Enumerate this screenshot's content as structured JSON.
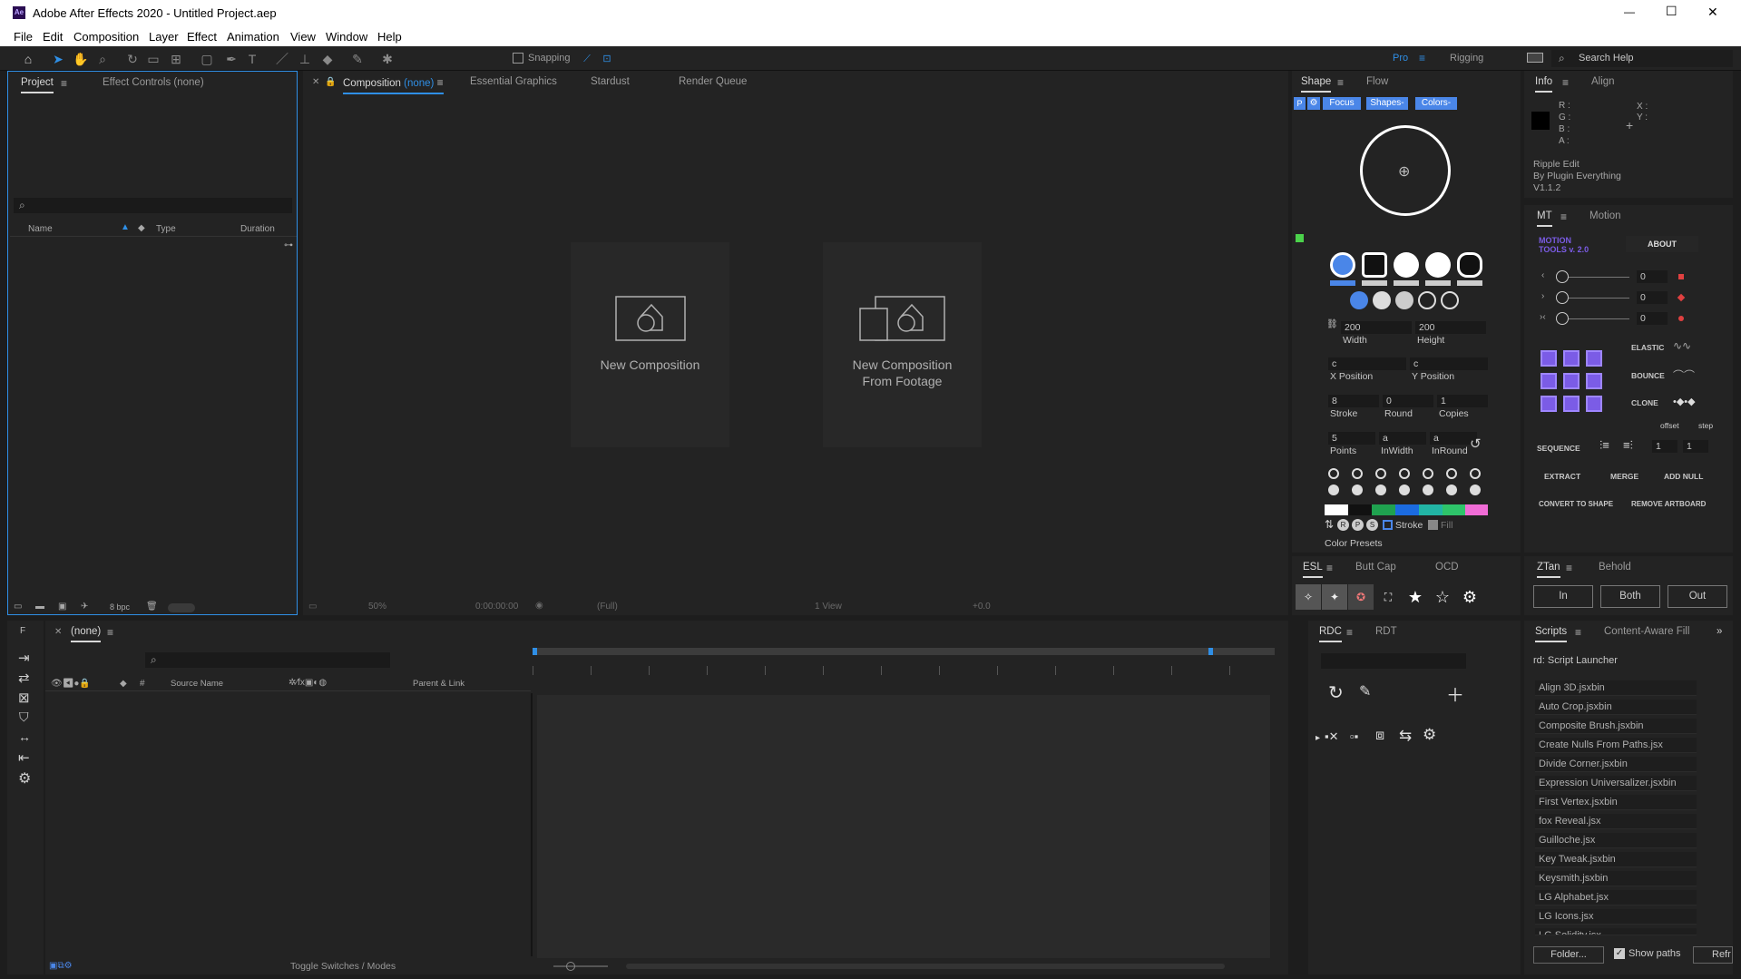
{
  "app": {
    "title": "Adobe After Effects 2020 - Untitled Project.aep",
    "logo": "Ae"
  },
  "window_controls": {
    "minimize": "—",
    "maximize": "☐",
    "close": "✕"
  },
  "menu": [
    "File",
    "Edit",
    "Composition",
    "Layer",
    "Effect",
    "Animation",
    "View",
    "Window",
    "Help"
  ],
  "toolbar": {
    "snapping": "Snapping",
    "workspaces": [
      "Pro",
      "Rigging"
    ],
    "search": "Search Help"
  },
  "project_panel": {
    "tabs": [
      "Project",
      "Effect Controls (none)"
    ],
    "columns": [
      "Name",
      "Type",
      "Duration"
    ],
    "bpc": "8 bpc"
  },
  "comp_panel": {
    "tabs": [
      "Composition",
      "(none)",
      "Essential Graphics",
      "Stardust",
      "Render Queue"
    ],
    "new_comp": "New Composition",
    "new_comp_footage_1": "New Composition",
    "new_comp_footage_2": "From Footage",
    "footer": {
      "zoom": "50%",
      "time": "0:00:00:00",
      "res": "(Full)",
      "view": "1 View",
      "exposure": "+0.0"
    }
  },
  "shape_panel": {
    "tabs": [
      "Shape",
      "Flow"
    ],
    "top_buttons": [
      "P",
      "Focus",
      "Shapes-",
      "Colors-"
    ],
    "width": "200",
    "height": "200",
    "width_label": "Width",
    "height_label": "Height",
    "xpos": "c",
    "ypos": "c",
    "xpos_label": "X Position",
    "ypos_label": "Y Position",
    "stroke": "8",
    "round": "0",
    "copies": "1",
    "stroke_label": "Stroke",
    "round_label": "Round",
    "copies_label": "Copies",
    "points": "5",
    "inwidth": "a",
    "inround": "a",
    "points_label": "Points",
    "inwidth_label": "InWidth",
    "inround_label": "InRound",
    "rps": [
      "R",
      "P",
      "S"
    ],
    "stroke_check": "Stroke",
    "fill_check": "Fill",
    "presets": "Color Presets"
  },
  "esl_panel": {
    "tabs": [
      "ESL",
      "Butt Cap",
      "OCD"
    ]
  },
  "info_panel": {
    "tabs": [
      "Info",
      "Align"
    ],
    "rgba": [
      "R :",
      "G :",
      "B :",
      "A :"
    ],
    "xy": [
      "X :",
      "Y :"
    ],
    "plugin": [
      "Ripple Edit",
      "By Plugin Everything",
      "V1.1.2"
    ]
  },
  "mt_panel": {
    "tabs": [
      "MT",
      "Motion"
    ],
    "logo_1": "MOTION",
    "logo_2": "TOOLS v. 2.0",
    "about": "ABOUT",
    "sliders": [
      "0",
      "0",
      "0"
    ],
    "elastic": "ELASTIC",
    "bounce": "BOUNCE",
    "clone": "CLONE",
    "offset": "offset",
    "step": "step",
    "sequence": "SEQUENCE",
    "seq_vals": [
      "1",
      "1"
    ],
    "extract": "EXTRACT",
    "merge": "MERGE",
    "add_null": "ADD NULL",
    "convert": "CONVERT TO SHAPE",
    "remove": "REMOVE ARTBOARD"
  },
  "ztan_panel": {
    "tabs": [
      "ZTan",
      "Behold"
    ],
    "buttons": [
      "In",
      "Both",
      "Out"
    ]
  },
  "timeline": {
    "tab": "(none)",
    "cols": [
      "Source Name",
      "Parent & Link"
    ],
    "footer": "Toggle Switches / Modes",
    "f_label": "F"
  },
  "rdc_panel": {
    "tabs": [
      "RDC",
      "RDT"
    ]
  },
  "scripts_panel": {
    "tabs": [
      "Scripts",
      "Content-Aware Fill"
    ],
    "title": "rd: Script Launcher",
    "items": [
      "Align 3D.jsxbin",
      "Auto Crop.jsxbin",
      "Composite Brush.jsxbin",
      "Create Nulls From Paths.jsx",
      "Divide Corner.jsxbin",
      "Expression Universalizer.jsxbin",
      "First Vertex.jsxbin",
      "fox Reveal.jsx",
      "Guilloche.jsx",
      "Key Tweak.jsxbin",
      "Keysmith.jsxbin",
      "LG Alphabet.jsx",
      "LG Icons.jsx",
      "LG Solidity.jsx"
    ],
    "folder": "Folder...",
    "show_paths": "Show paths",
    "refresh": "Refr"
  },
  "colors": {
    "accent": "#2f8fe6",
    "shape_blue": "#4a86e8",
    "purple": "#7b5ce6"
  }
}
